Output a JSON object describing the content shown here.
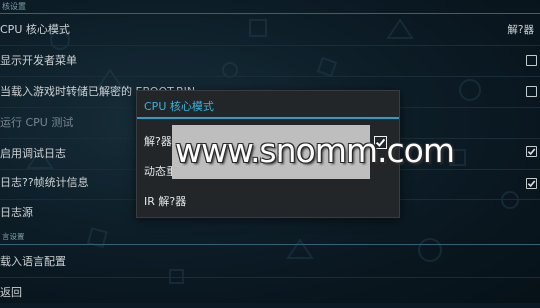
{
  "header": {
    "section_label": "核设置"
  },
  "settings": {
    "cpu_core": {
      "label": "CPU 核心模式",
      "value": "解?器"
    },
    "dev_menu": {
      "label": "显示开发者菜单",
      "checked": false
    },
    "eboot_decrypt": {
      "label": "当载入游戏时转储已解密的 EBOOT.BIN",
      "checked": false
    },
    "run_cpu_test": {
      "label": "运行 CPU 测试"
    },
    "debug_log": {
      "label": "启用调试日志",
      "checked": true
    },
    "frame_stats": {
      "label": "日志??帧统计信息",
      "checked": true
    },
    "log_source": {
      "label": "日志源"
    }
  },
  "section2": {
    "label": "言设置"
  },
  "load_lang": {
    "label": "载入语言配置"
  },
  "back": {
    "label": "返回"
  },
  "dialog": {
    "title": "CPU 核心模式",
    "options": [
      {
        "label": "解?器",
        "checked": true
      },
      {
        "label": "动态重编译 (JIT)"
      },
      {
        "label": "IR 解?器"
      }
    ]
  },
  "watermark": {
    "text": "www.snomm.com"
  },
  "colors": {
    "accent": "#2d9cc6",
    "dialog_bg": "#232628"
  }
}
